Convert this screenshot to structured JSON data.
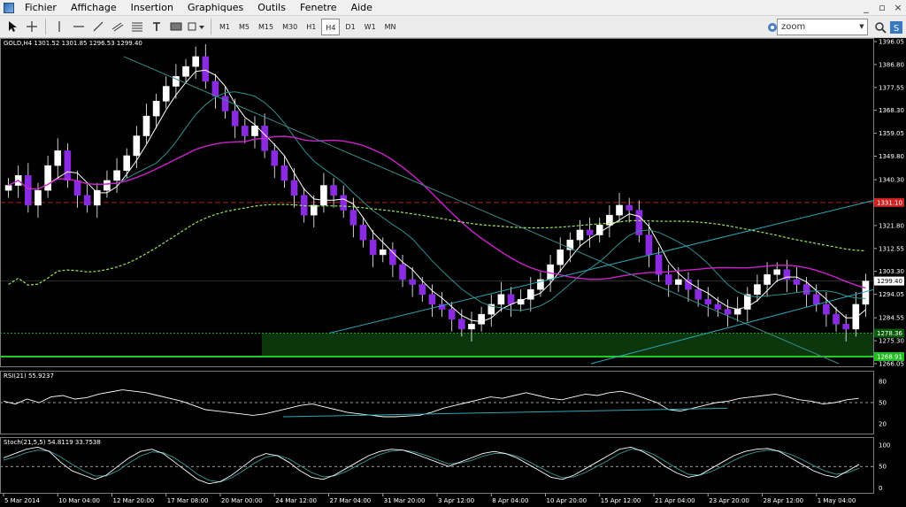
{
  "menu": {
    "items": [
      "Fichier",
      "Affichage",
      "Insertion",
      "Graphiques",
      "Outils",
      "Fenetre",
      "Aide"
    ],
    "minimize": "_",
    "restore": "▫",
    "close": "×"
  },
  "toolbar": {
    "timeframes": [
      "M1",
      "M5",
      "M15",
      "M30",
      "H1",
      "H4",
      "D1",
      "W1",
      "MN"
    ],
    "active_timeframe": "H4",
    "search_value": "zoom",
    "icons": [
      "cursor-icon",
      "crosshair-icon",
      "vertical-line-icon",
      "horizontal-line-icon",
      "trendline-icon",
      "channel-icon",
      "fibonacci-icon",
      "text-icon",
      "label-icon",
      "shapes-icon"
    ]
  },
  "main": {
    "header": "GOLD,H4  1301.52 1301.85 1296.53 1299.40",
    "price_axis": [
      "1396.05",
      "1386.80",
      "1377.55",
      "1368.30",
      "1359.05",
      "1349.80",
      "1340.30",
      "1331.05",
      "1321.80",
      "1312.55",
      "1303.30",
      "1294.05",
      "1284.55",
      "1275.30",
      "1266.05"
    ],
    "price_tags": [
      {
        "text": "1331.10",
        "value": 1331.1,
        "color": "#cc2222"
      },
      {
        "text": "1299.40",
        "value": 1299.4,
        "color": "#ffffff"
      },
      {
        "text": "1278.36",
        "value": 1278.36,
        "color": "#0a5a0a"
      },
      {
        "text": "1268.91",
        "value": 1268.91,
        "color": "#22bb22"
      }
    ]
  },
  "rsi": {
    "header": "RSI(21) 55.9237",
    "axis": [
      "80",
      "50",
      "20"
    ],
    "level": 50
  },
  "stoch": {
    "header": "Stoch(21,5,5) 54.8119 33.7538",
    "axis": [
      "100",
      "50",
      "0"
    ],
    "level": 50
  },
  "time_axis": [
    "5 Mar 2014",
    "10 Mar 04:00",
    "12 Mar 20:00",
    "17 Mar 08:00",
    "20 Mar 00:00",
    "24 Mar 12:00",
    "27 Mar 04:00",
    "31 Mar 20:00",
    "3 Apr 12:00",
    "8 Apr 04:00",
    "10 Apr 20:00",
    "15 Apr 12:00",
    "21 Apr 04:00",
    "23 Apr 20:00",
    "28 Apr 12:00",
    "1 May 04:00"
  ],
  "chart_data": {
    "type": "candlestick",
    "symbol": "GOLD",
    "timeframe": "H4",
    "ylim": [
      1266.05,
      1396.05
    ],
    "candles_close": [
      1338,
      1342,
      1330,
      1336,
      1346,
      1352,
      1340,
      1334,
      1330,
      1336,
      1340,
      1344,
      1350,
      1358,
      1366,
      1372,
      1378,
      1382,
      1386,
      1390,
      1380,
      1374,
      1368,
      1362,
      1358,
      1362,
      1352,
      1346,
      1340,
      1334,
      1326,
      1330,
      1338,
      1334,
      1328,
      1322,
      1316,
      1310,
      1312,
      1306,
      1300,
      1298,
      1294,
      1290,
      1288,
      1284,
      1280,
      1282,
      1286,
      1290,
      1294,
      1290,
      1292,
      1296,
      1300,
      1306,
      1312,
      1316,
      1320,
      1318,
      1322,
      1326,
      1330,
      1328,
      1318,
      1310,
      1302,
      1298,
      1300,
      1296,
      1292,
      1290,
      1288,
      1286,
      1288,
      1294,
      1298,
      1302,
      1304,
      1300,
      1298,
      1294,
      1290,
      1286,
      1282,
      1280,
      1290,
      1299.4
    ],
    "series": [
      {
        "name": "MA fast",
        "color": "#ffffff"
      },
      {
        "name": "MA mid",
        "color": "#2f8f8f"
      },
      {
        "name": "MA slow",
        "color": "#cc22cc"
      },
      {
        "name": "MA long",
        "color": "#9ae65c"
      }
    ],
    "rsi_values": [
      52,
      48,
      55,
      50,
      58,
      60,
      55,
      57,
      62,
      65,
      68,
      66,
      64,
      60,
      56,
      52,
      46,
      40,
      38,
      36,
      34,
      32,
      34,
      38,
      42,
      46,
      48,
      44,
      40,
      36,
      34,
      32,
      30,
      30,
      31,
      32,
      36,
      42,
      46,
      50,
      54,
      58,
      56,
      60,
      64,
      60,
      56,
      54,
      58,
      62,
      60,
      64,
      66,
      62,
      56,
      50,
      40,
      38,
      42,
      46,
      50,
      52,
      56,
      58,
      60,
      62,
      58,
      54,
      52,
      48,
      50,
      54,
      56
    ],
    "stoch_main": [
      70,
      80,
      90,
      95,
      85,
      60,
      40,
      30,
      20,
      30,
      50,
      70,
      85,
      90,
      80,
      60,
      40,
      20,
      10,
      15,
      30,
      50,
      70,
      80,
      75,
      60,
      40,
      25,
      20,
      30,
      45,
      60,
      75,
      85,
      90,
      88,
      80,
      70,
      60,
      50,
      60,
      70,
      80,
      85,
      80,
      70,
      55,
      40,
      25,
      20,
      30,
      45,
      60,
      75,
      90,
      95,
      85,
      70,
      50,
      35,
      25,
      30,
      45,
      60,
      75,
      85,
      90,
      92,
      85,
      70,
      55,
      40,
      30,
      25,
      40,
      55
    ],
    "stoch_signal": [
      65,
      72,
      82,
      88,
      86,
      72,
      55,
      40,
      28,
      28,
      40,
      58,
      74,
      84,
      82,
      70,
      52,
      32,
      18,
      14,
      24,
      40,
      58,
      72,
      76,
      68,
      52,
      36,
      26,
      28,
      38,
      52,
      66,
      78,
      86,
      88,
      84,
      76,
      66,
      56,
      58,
      64,
      74,
      80,
      80,
      74,
      62,
      48,
      34,
      24,
      26,
      36,
      50,
      64,
      80,
      90,
      88,
      78,
      62,
      46,
      32,
      30,
      38,
      50,
      64,
      76,
      84,
      88,
      86,
      78,
      66,
      52,
      40,
      32,
      36,
      46
    ]
  }
}
